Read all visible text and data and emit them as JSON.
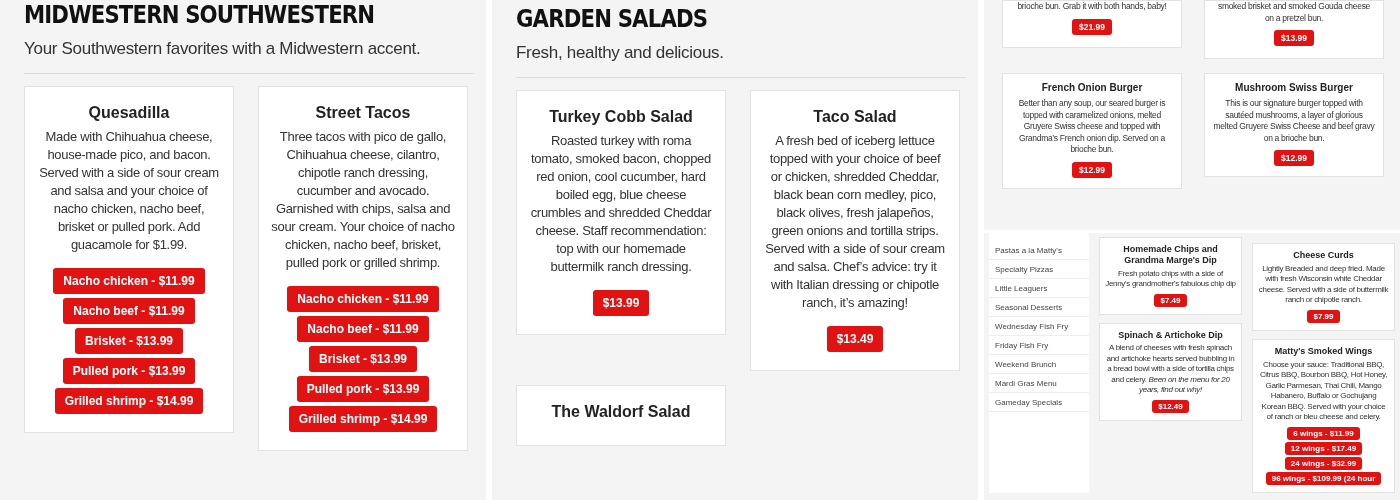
{
  "panels": [
    {
      "kind": "section",
      "heading": "MIDWESTERN SOUTHWESTERN",
      "subtitle": "Your Southwestern favorites with a Midwestern accent.",
      "cards": [
        {
          "title": "Quesadilla",
          "description": "Made with Chihuahua cheese, house-made pico, and bacon. Served with a side of sour cream and salsa and your choice of nacho chicken, nacho beef, brisket or pulled pork. Add guacamole for $1.99.",
          "prices": [
            "Nacho chicken - $11.99",
            "Nacho beef - $11.99",
            "Brisket - $13.99",
            "Pulled pork - $13.99",
            "Grilled shrimp - $14.99"
          ]
        },
        {
          "title": "Street Tacos",
          "description": "Three tacos with pico de gallo, Chihuahua cheese, cilantro, chipotle ranch dressing, cucumber and avocado. Garnished with chips, salsa and sour cream. Your choice of nacho chicken, nacho beef, brisket, pulled pork or grilled shrimp.",
          "prices": [
            "Nacho chicken - $11.99",
            "Nacho beef - $11.99",
            "Brisket - $13.99",
            "Pulled pork - $13.99",
            "Grilled shrimp - $14.99"
          ]
        }
      ]
    },
    {
      "kind": "section",
      "heading": "GARDEN SALADS",
      "subtitle": "Fresh, healthy and delicious.",
      "cards": [
        {
          "title": "Turkey Cobb Salad",
          "description": "Roasted turkey with roma tomato, smoked bacon, chopped red onion, cool cucumber, hard boiled egg, blue cheese crumbles and shredded Cheddar cheese. Staff recommendation: top with our homemade buttermilk ranch dressing.",
          "prices": [
            "$13.99"
          ]
        },
        {
          "title": "Taco Salad",
          "description": "A fresh bed of iceberg lettuce topped with your choice of beef or chicken, shredded Cheddar, black bean corn medley, pico, black olives, fresh jalapeños, green onions and tortilla strips. Served with a side of sour cream and salsa. Chef’s advice: try it with Italian dressing or chipotle ranch, it’s amazing!",
          "prices": [
            "$13.49"
          ]
        },
        {
          "title": "The Waldorf Salad"
        }
      ]
    },
    {
      "kind": "grid",
      "cards": [
        {
          "description": "brioche bun. Grab it with both hands, baby!",
          "prices": [
            "$21.99"
          ]
        },
        {
          "description": "smoked brisket and smoked Gouda cheese on a pretzel bun.",
          "prices": [
            "$13.99"
          ]
        },
        {
          "title": "French Onion Burger",
          "description": "Better than any soup, our seared burger is topped with caramelized onions, melted Gruyere Swiss cheese and topped with Grandma’s French onion dip. Served on a brioche bun.",
          "prices": [
            "$12.99"
          ]
        },
        {
          "title": "Mushroom Swiss Burger",
          "description": "This is our signature burger topped with sautéed mushrooms, a layer of glorious melted Gruyere Swiss Cheese and beef gravy on a brioche bun.",
          "prices": [
            "$12.99"
          ]
        }
      ]
    },
    {
      "kind": "menu",
      "sidebar": [
        "Pastas a la Matty's",
        "Specialty Pizzas",
        "Little Leaguers",
        "Seasonal Desserts",
        "Wednesday Fish Fry",
        "Friday Fish Fry",
        "Weekend Brunch",
        "Mardi Gras Menu",
        "Gameday Specials"
      ],
      "columns": [
        [
          {
            "title": "Homemade Chips and Grandma Marge's Dip",
            "description": "Fresh potato chips with a side of Jenny's grandmother's fabulous chip dip",
            "prices": [
              "$7.49"
            ]
          },
          {
            "title": "Spinach & Artichoke Dip",
            "description": "A blend of cheeses with fresh spinach and artichoke hearts served bubbling in a bread bowl with a side of tortilla chips and celery. *Been on the menu for 20 years, find out why!*",
            "prices": [
              "$12.49"
            ]
          }
        ],
        [
          {
            "title": "Cheese Curds",
            "description": "Lightly Breaded and deep fried. Made with fresh Wisconsin white Cheddar cheese. Served with a side of buttermilk ranch or chipotle ranch.",
            "prices": [
              "$7.99"
            ]
          },
          {
            "title": "Matty's Smoked Wings",
            "description": "Choose your sauce: Traditional BBQ, Citrus BBQ, Bourbon BBQ, Hot Honey, Garlic Parmesan, Thai Chili, Mango Habanero, Buffalo or Gochujang Korean BBQ. Served with your choice of ranch or bleu cheese and celery.",
            "prices": [
              "6 wings - $11.99",
              "12 wings - $17.49",
              "24 wings - $32.99",
              "96 wings - $109.99 (24 hour"
            ]
          }
        ]
      ]
    }
  ]
}
